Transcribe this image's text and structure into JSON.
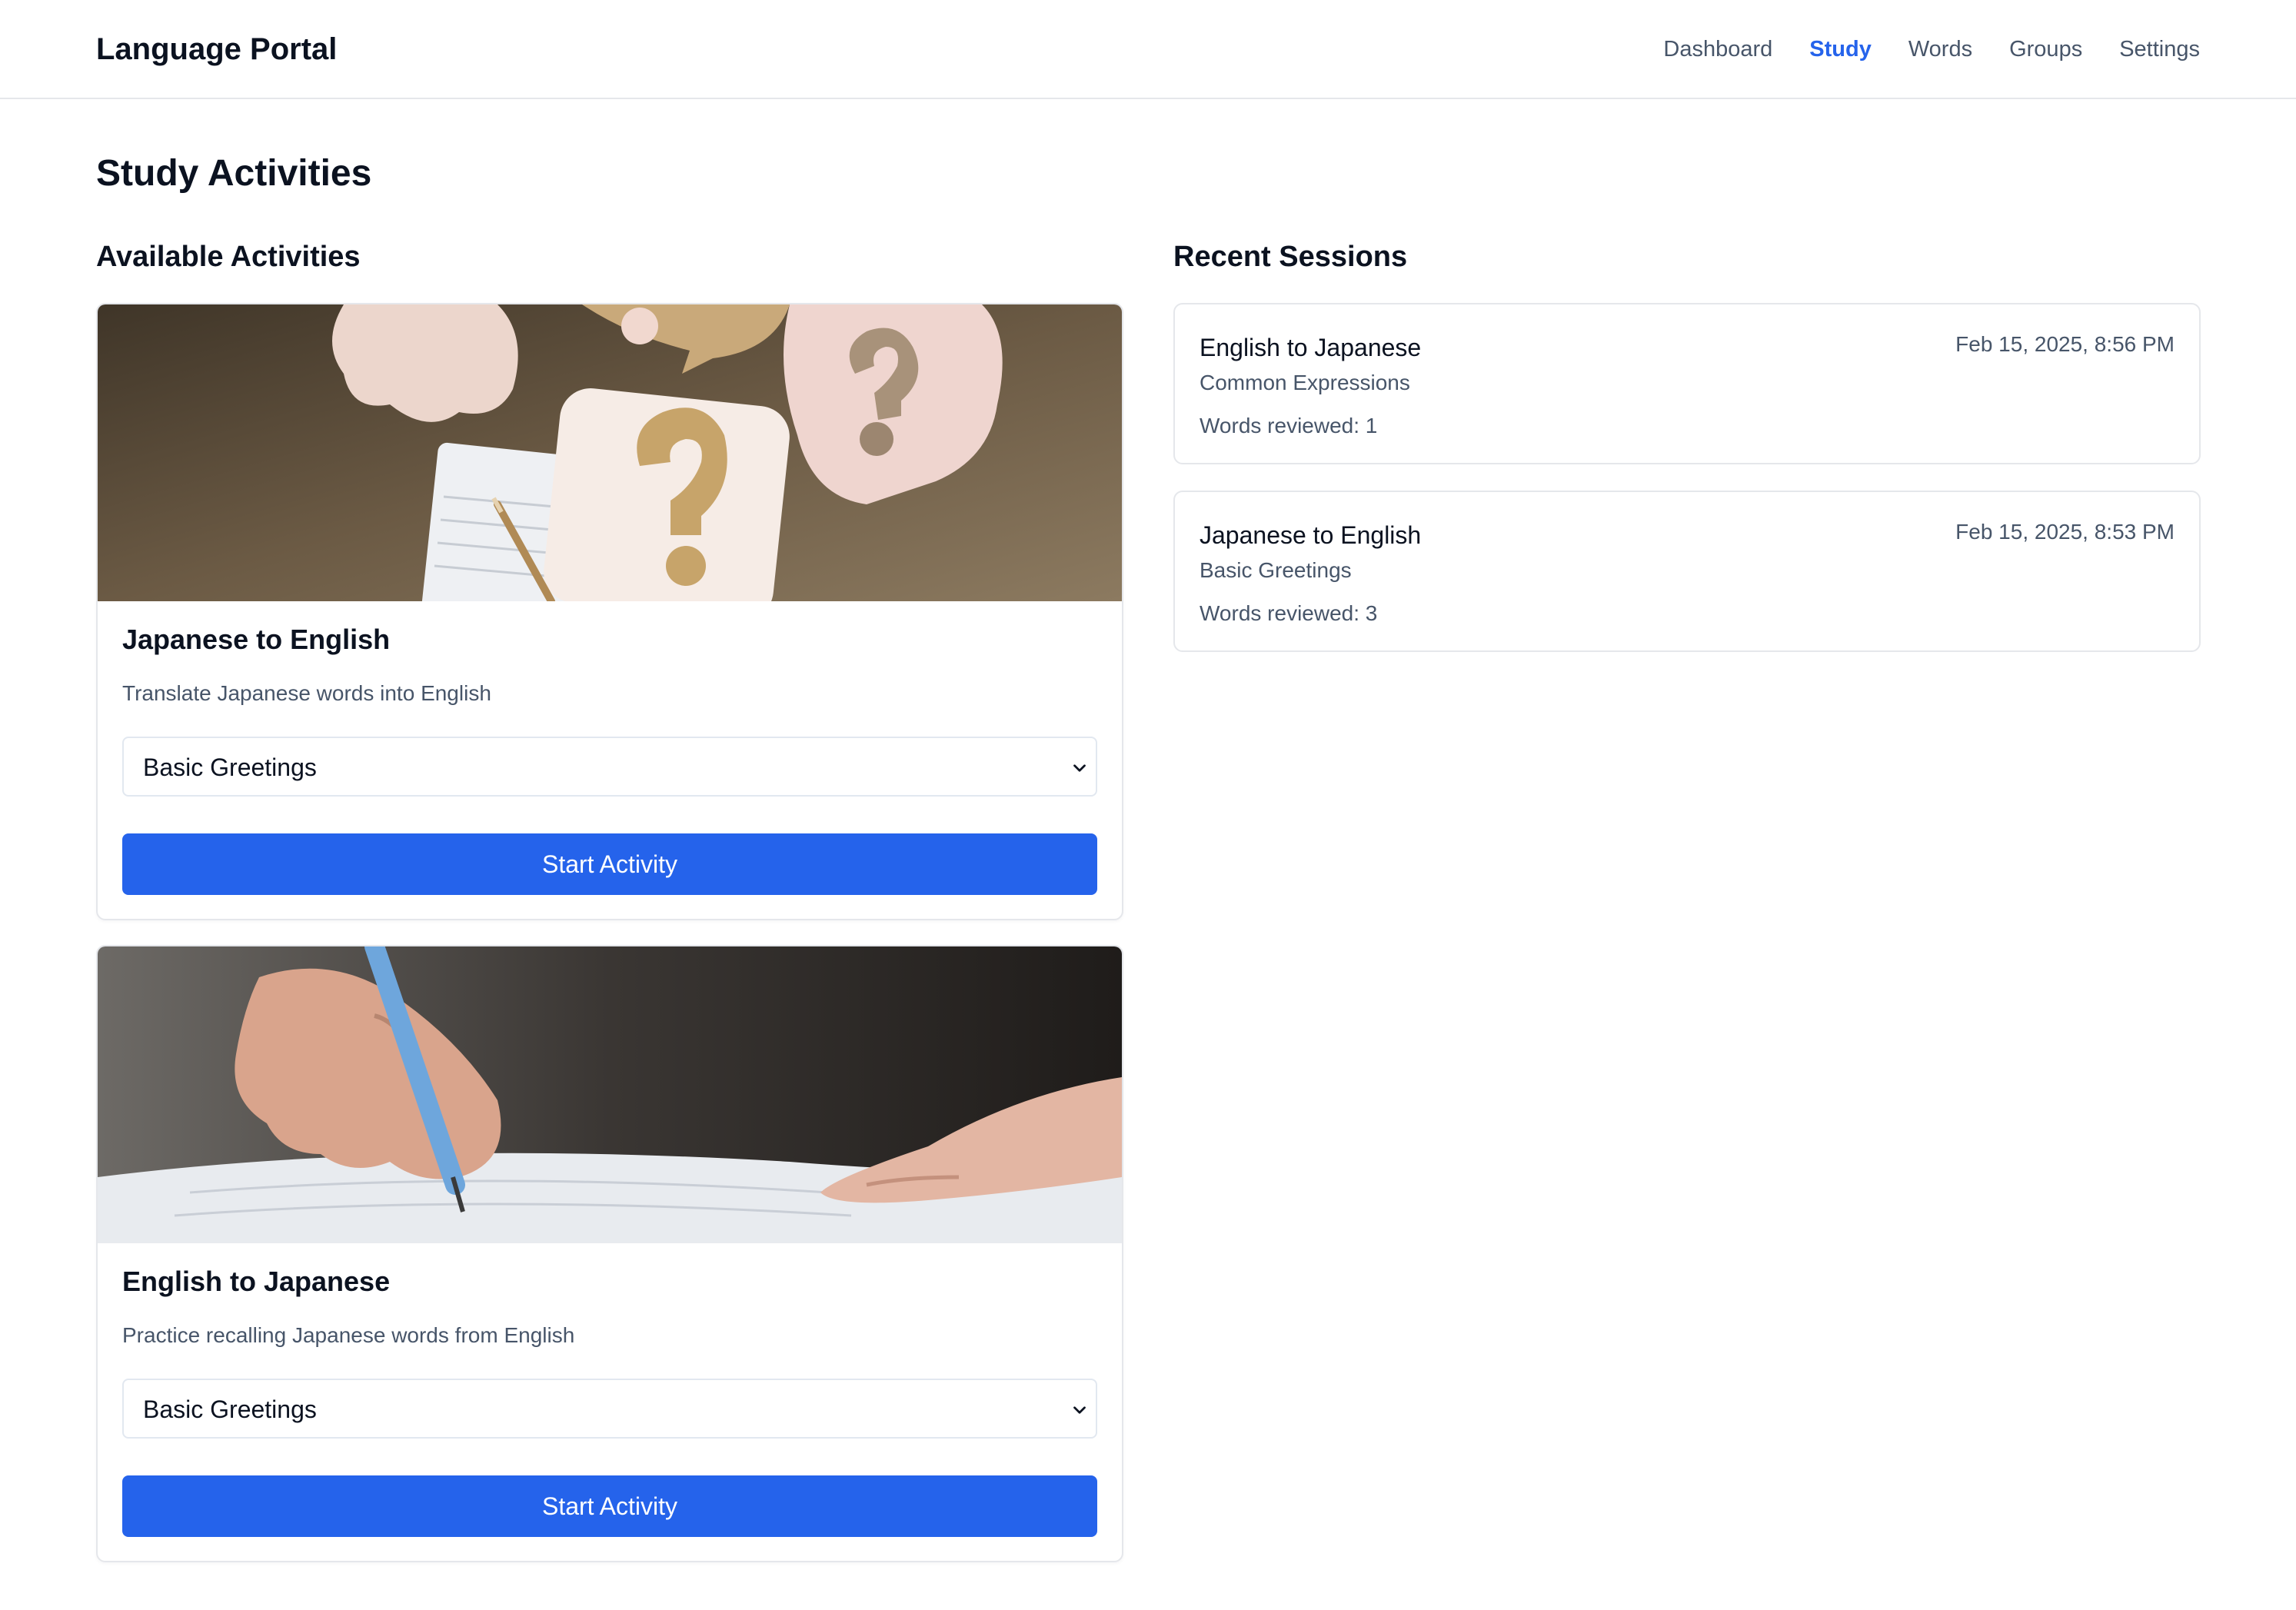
{
  "header": {
    "brand": "Language Portal",
    "nav": [
      "Dashboard",
      "Study",
      "Words",
      "Groups",
      "Settings"
    ],
    "active_nav": "Study"
  },
  "page": {
    "title": "Study Activities",
    "available_title": "Available Activities",
    "recent_title": "Recent Sessions"
  },
  "activities": [
    {
      "title": "Japanese to English",
      "description": "Translate Japanese words into English",
      "selected_group": "Basic Greetings",
      "button": "Start Activity",
      "image": "question-marks-speech-bubbles-photo"
    },
    {
      "title": "English to Japanese",
      "description": "Practice recalling Japanese words from English",
      "selected_group": "Basic Greetings",
      "button": "Start Activity",
      "image": "hand-writing-with-pen-photo"
    }
  ],
  "sessions": [
    {
      "activity": "English to Japanese",
      "group": "Common Expressions",
      "words_reviewed": "Words reviewed: 1",
      "date": "Feb 15, 2025, 8:56 PM"
    },
    {
      "activity": "Japanese to English",
      "group": "Basic Greetings",
      "words_reviewed": "Words reviewed: 3",
      "date": "Feb 15, 2025, 8:53 PM"
    }
  ],
  "colors": {
    "accent": "#2563eb",
    "muted_text": "#475569",
    "border": "#e5e7eb"
  }
}
